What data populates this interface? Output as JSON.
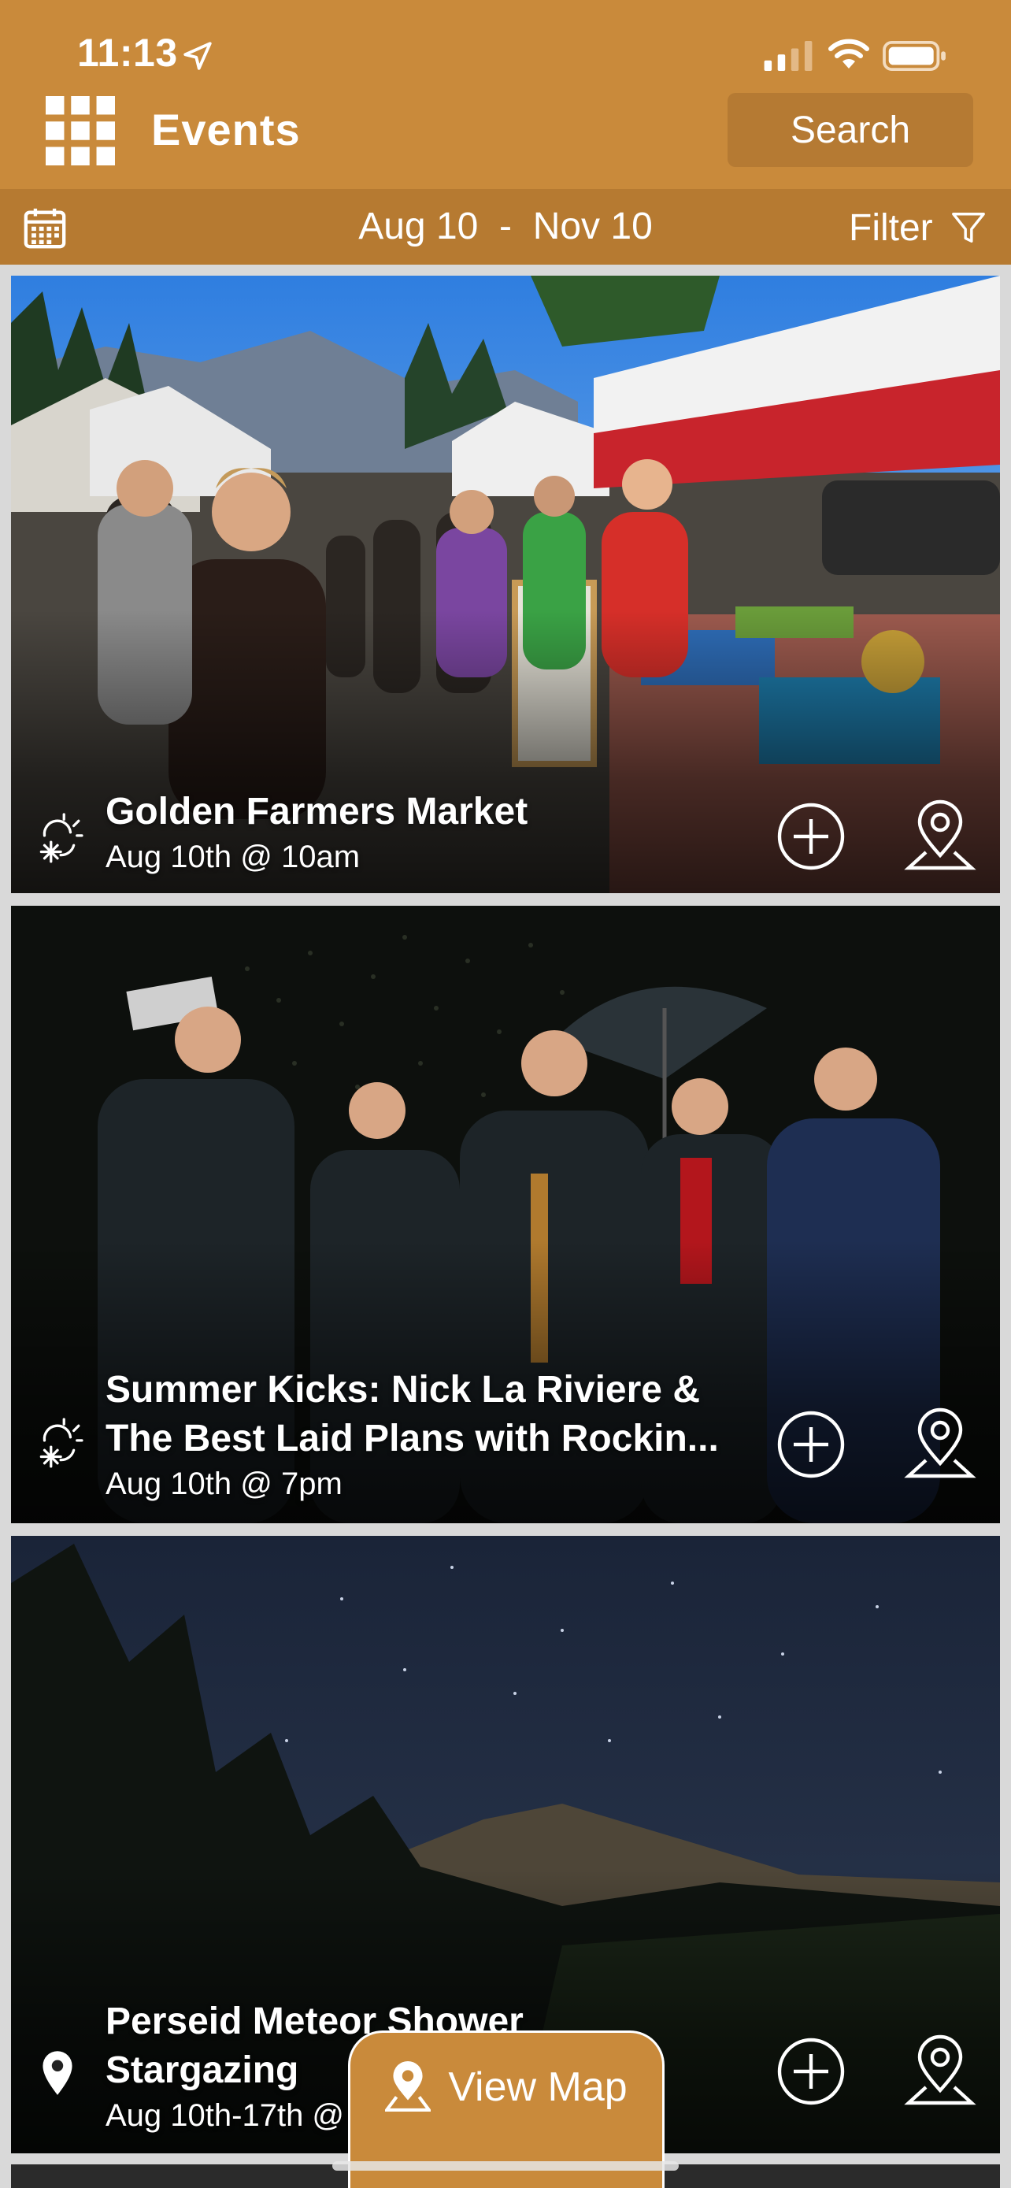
{
  "status_bar": {
    "time": "11:13"
  },
  "header": {
    "title": "Events",
    "search_label": "Search",
    "menu_icon": "grid-menu-icon"
  },
  "date_bar": {
    "start": "Aug 10",
    "separator": "-",
    "end": "Nov 10",
    "filter_label": "Filter",
    "calendar_icon": "calendar-icon",
    "filter_icon": "filter-funnel-icon"
  },
  "events": [
    {
      "title": "Golden Farmers Market",
      "date": "Aug 10th @ 10am",
      "type_icon": "seasonal-snowflake-sun-icon",
      "image_subject": "farmers market crowd"
    },
    {
      "title": "Summer Kicks: Nick La Riviere & The Best Laid Plans with Rockin...",
      "date": "Aug 10th @ 7pm",
      "type_icon": "seasonal-snowflake-sun-icon",
      "image_subject": "band portrait"
    },
    {
      "title": "Perseid Meteor Shower Stargazing",
      "date": "Aug 10th-17th @",
      "type_icon": "location-pin-icon",
      "image_subject": "night sky mountains"
    }
  ],
  "view_map": {
    "label": "View Map"
  },
  "colors": {
    "brand": "#c98a3b",
    "brand_dark": "#b67a31",
    "text_on_brand": "#ffffff"
  }
}
